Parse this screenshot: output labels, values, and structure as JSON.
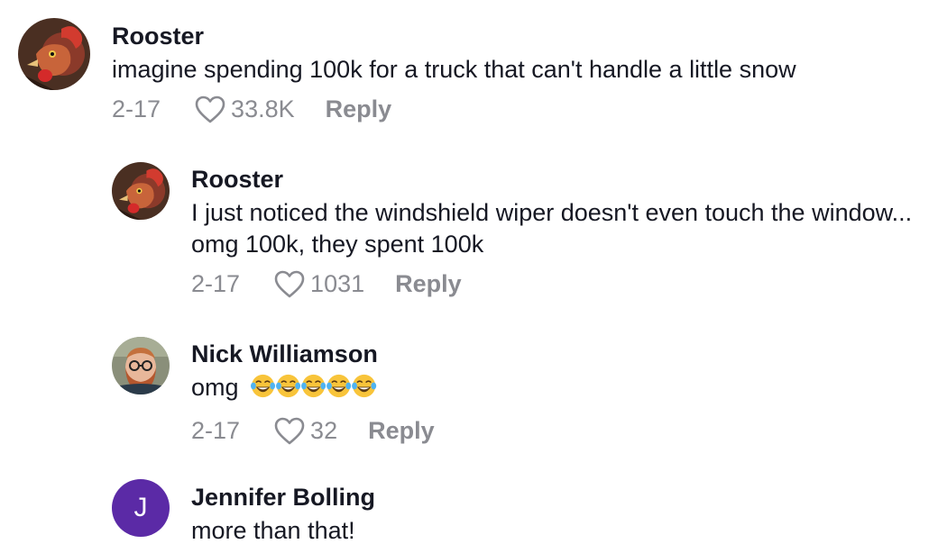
{
  "comments": [
    {
      "username": "Rooster",
      "text": "imagine spending 100k for a truck that can't handle a little snow",
      "date": "2-17",
      "likes": "33.8K",
      "reply_label": "Reply",
      "avatar_icon": "rooster-avatar"
    },
    {
      "username": "Rooster",
      "text": "I just noticed the windshield wiper doesn't even touch the window... omg 100k, they spent 100k",
      "date": "2-17",
      "likes": "1031",
      "reply_label": "Reply",
      "avatar_icon": "rooster-avatar"
    },
    {
      "username": "Nick Williamson",
      "text": "omg",
      "emoji": "😂😂😂😂😂",
      "date": "2-17",
      "likes": "32",
      "reply_label": "Reply",
      "avatar_icon": "man-with-glasses-avatar"
    },
    {
      "username": "Jennifer Bolling",
      "text": "more than that!",
      "avatar_initial": "J",
      "avatar_color": "#5b2aa6"
    }
  ],
  "colors": {
    "text": "#161823",
    "meta": "#8a8b91",
    "background": "#ffffff"
  }
}
